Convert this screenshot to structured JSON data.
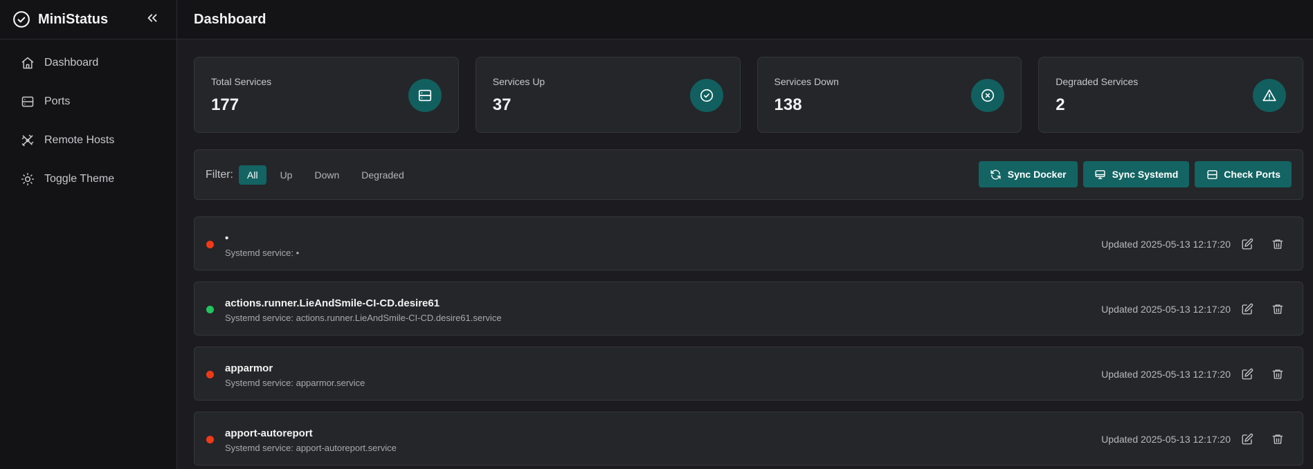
{
  "app": {
    "name": "MiniStatus"
  },
  "sidebar": {
    "items": [
      {
        "label": "Dashboard",
        "icon": "home-icon"
      },
      {
        "label": "Ports",
        "icon": "server-icon"
      },
      {
        "label": "Remote Hosts",
        "icon": "network-icon"
      },
      {
        "label": "Toggle Theme",
        "icon": "sun-icon"
      }
    ]
  },
  "header": {
    "title": "Dashboard"
  },
  "stats": [
    {
      "label": "Total Services",
      "value": "177",
      "icon": "server-icon"
    },
    {
      "label": "Services Up",
      "value": "37",
      "icon": "check-circle-icon"
    },
    {
      "label": "Services Down",
      "value": "138",
      "icon": "x-circle-icon"
    },
    {
      "label": "Degraded Services",
      "value": "2",
      "icon": "warning-icon"
    }
  ],
  "filter": {
    "label": "Filter:",
    "options": [
      "All",
      "Up",
      "Down",
      "Degraded"
    ],
    "selected": "All"
  },
  "actions": [
    {
      "label": "Sync Docker",
      "icon": "refresh-icon"
    },
    {
      "label": "Sync Systemd",
      "icon": "monitor-icon"
    },
    {
      "label": "Check Ports",
      "icon": "server-icon"
    }
  ],
  "services": [
    {
      "name": "•",
      "description": "Systemd service: •",
      "status": "down",
      "updated": "Updated 2025-05-13 12:17:20"
    },
    {
      "name": "actions.runner.LieAndSmile-CI-CD.desire61",
      "description": "Systemd service: actions.runner.LieAndSmile-CI-CD.desire61.service",
      "status": "up",
      "updated": "Updated 2025-05-13 12:17:20"
    },
    {
      "name": "apparmor",
      "description": "Systemd service: apparmor.service",
      "status": "down",
      "updated": "Updated 2025-05-13 12:17:20"
    },
    {
      "name": "apport-autoreport",
      "description": "Systemd service: apport-autoreport.service",
      "status": "down",
      "updated": "Updated 2025-05-13 12:17:20"
    }
  ],
  "colors": {
    "accent": "#136463",
    "status_up": "#22c55e",
    "status_down": "#f03a17",
    "status_degraded": "#eab308"
  }
}
